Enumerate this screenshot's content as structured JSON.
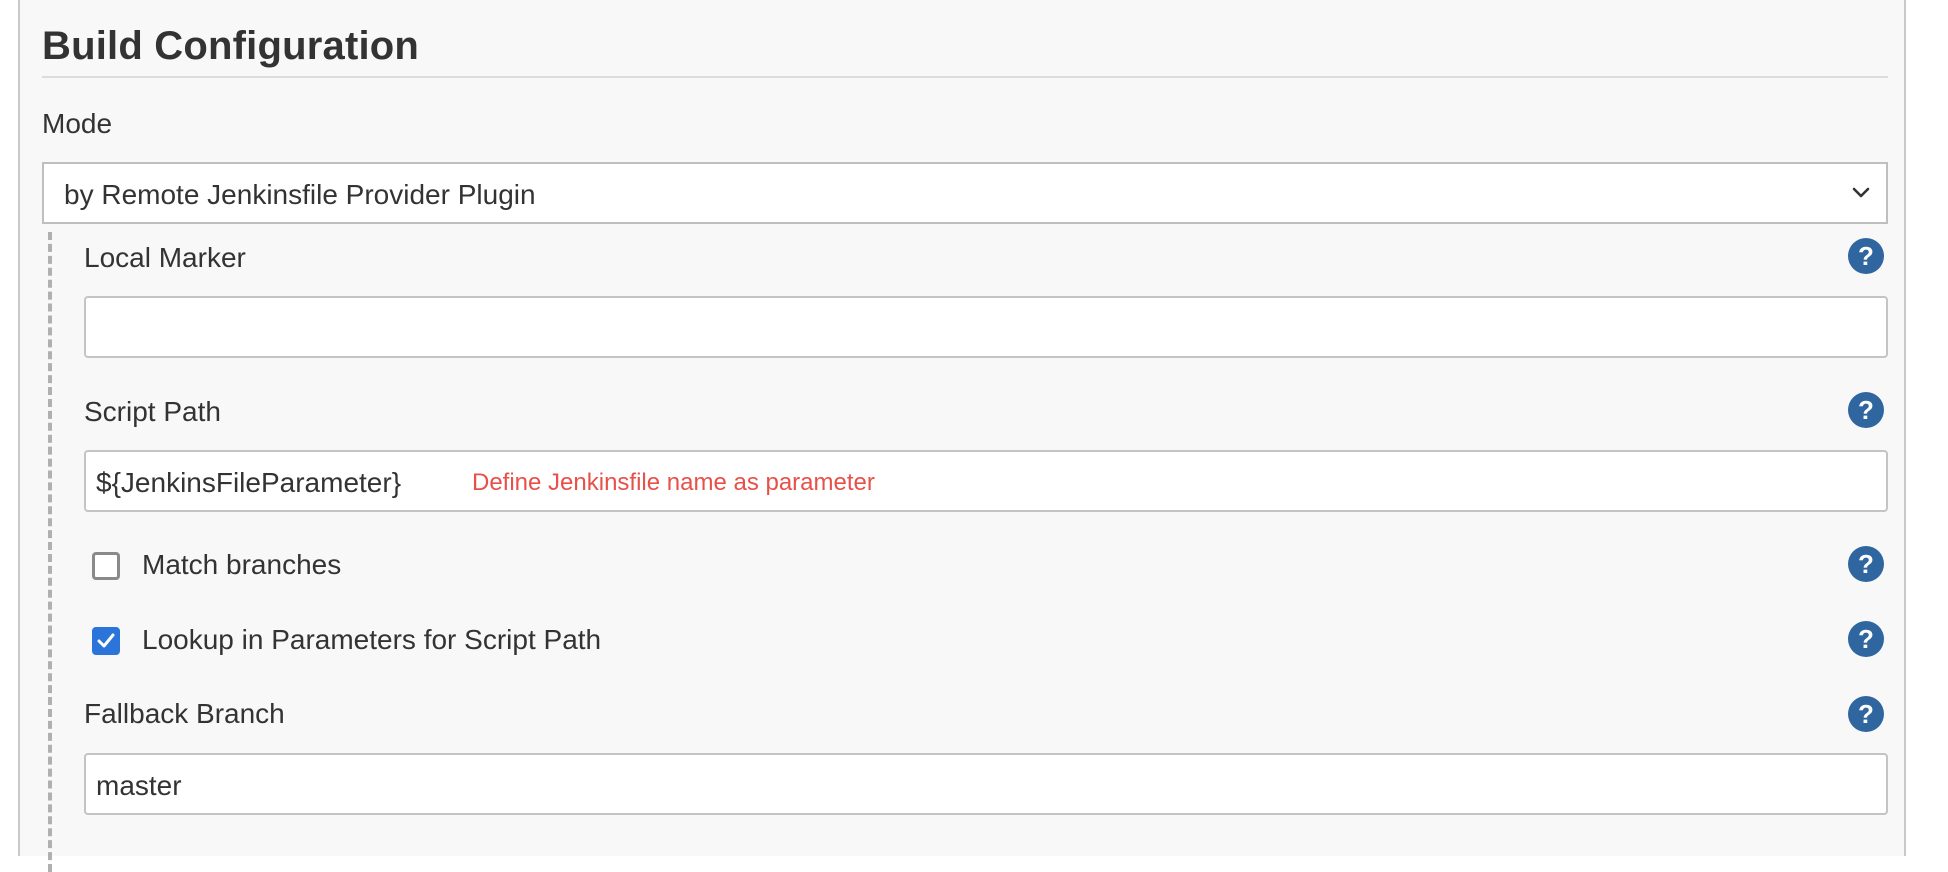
{
  "section": {
    "title": "Build Configuration"
  },
  "mode": {
    "label": "Mode",
    "selected": "by Remote Jenkinsfile Provider Plugin"
  },
  "local_marker": {
    "label": "Local Marker",
    "value": "",
    "help": "?"
  },
  "script_path": {
    "label": "Script Path",
    "value": "${JenkinsFileParameter}",
    "hint": "Define Jenkinsfile name as parameter",
    "help": "?"
  },
  "match_branches": {
    "label": "Match branches",
    "checked": false,
    "help": "?"
  },
  "lookup_params": {
    "label": "Lookup in Parameters for Script Path",
    "checked": true,
    "help": "?"
  },
  "fallback_branch": {
    "label": "Fallback Branch",
    "value": "master",
    "help": "?"
  },
  "icons": {
    "help": "question-circle-icon",
    "dropdown": "chevron-down-icon",
    "checkmark": "checkmark-icon"
  },
  "colors": {
    "help_icon": "#2f669f",
    "checkbox_checked": "#2a74da",
    "hint_text": "#e8504a",
    "panel_background": "#f8f8f8"
  }
}
